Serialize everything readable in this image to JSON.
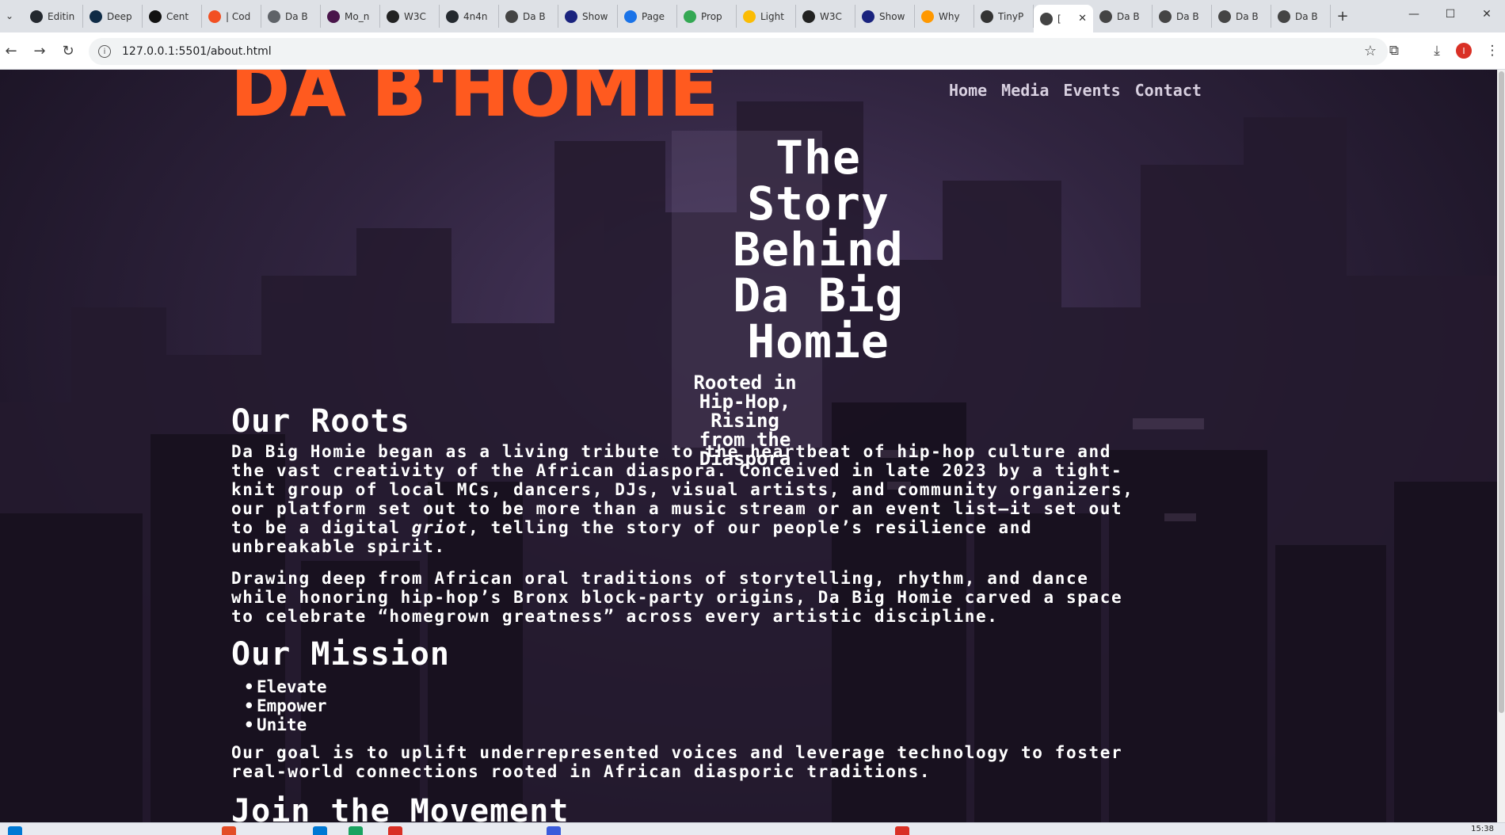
{
  "browser": {
    "tabs": [
      {
        "label": "Editin",
        "icon": "github-icon",
        "color": "#24292f"
      },
      {
        "label": "Deep",
        "icon": "deepl-icon",
        "color": "#0f2b46"
      },
      {
        "label": "Cent",
        "icon": "openai-icon",
        "color": "#111111"
      },
      {
        "label": "| Cod",
        "icon": "circle-icon",
        "color": "#f25022"
      },
      {
        "label": "Da B",
        "icon": "globe-icon",
        "color": "#5f6368"
      },
      {
        "label": "Mo_n",
        "icon": "slack-icon",
        "color": "#4a154b"
      },
      {
        "label": "W3C",
        "icon": "w3c-icon",
        "color": "#222222"
      },
      {
        "label": "4n4n",
        "icon": "github-icon",
        "color": "#24292f"
      },
      {
        "label": "Da B",
        "icon": "page-icon",
        "color": "#444444"
      },
      {
        "label": "Show",
        "icon": "logo-icon",
        "color": "#1a237e"
      },
      {
        "label": "Page",
        "icon": "speed-icon",
        "color": "#1a73e8"
      },
      {
        "label": "Prop",
        "icon": "chrome-icon",
        "color": "#34a853"
      },
      {
        "label": "Light",
        "icon": "chrome-icon",
        "color": "#fbbc04"
      },
      {
        "label": "W3C",
        "icon": "w3c-icon",
        "color": "#222222"
      },
      {
        "label": "Show",
        "icon": "logo-icon",
        "color": "#1a237e"
      },
      {
        "label": "Why",
        "icon": "firebase-icon",
        "color": "#ff9800"
      },
      {
        "label": "TinyP",
        "icon": "panda-icon",
        "color": "#333333"
      },
      {
        "label": "[",
        "icon": "page-icon",
        "color": "#444444",
        "active": true
      },
      {
        "label": "Da B",
        "icon": "page-icon",
        "color": "#444444"
      },
      {
        "label": "Da B",
        "icon": "page-icon",
        "color": "#444444"
      },
      {
        "label": "Da B",
        "icon": "page-icon",
        "color": "#444444"
      },
      {
        "label": "Da B",
        "icon": "page-icon",
        "color": "#444444"
      }
    ],
    "url": "127.0.0.1:5501/about.html",
    "profile_initial": "I"
  },
  "site": {
    "logo": "DA B'HOMIE",
    "nav": [
      "Home",
      "Media",
      "Events",
      "Contact"
    ],
    "hero_title_lines": [
      "The",
      "Story",
      "Behind",
      "Da Big",
      "Homie"
    ],
    "hero_sub_lines": [
      "Rooted in",
      "Hip-Hop,",
      "Rising",
      "from the",
      "Diaspora"
    ],
    "roots_heading": "Our Roots",
    "roots_p1": [
      "Da Big Homie began as a living tribute to the heartbeat of hip-hop culture and",
      "the vast creativity of the African diaspora. Conceived in late 2023 by a tight-",
      "knit group of local MCs, dancers, DJs, visual artists, and community organizers,",
      "our platform set out to be more than a music stream or an event list—it set out",
      "to be a digital griot, telling the story of our people’s resilience and",
      "unbreakable spirit."
    ],
    "roots_p2": [
      "Drawing deep from African oral traditions of storytelling, rhythm, and dance",
      "while honoring hip-hop’s Bronx block-party origins, Da Big Homie carved a space",
      "to celebrate “homegrown greatness” across every artistic discipline."
    ],
    "mission_heading": "Our Mission",
    "mission_items": [
      "Elevate",
      "Empower",
      "Unite"
    ],
    "mission_p": [
      "Our goal is to uplift underrepresented voices and leverage technology to foster",
      "real-world connections rooted in African diasporic traditions."
    ],
    "join_heading": "Join the Movement"
  },
  "taskbar": {
    "clock": "15:38"
  },
  "colors": {
    "logo": "#ff5a1f",
    "text": "#ffffff",
    "nav": "#d8d0e0",
    "bg": "#2a1f36"
  }
}
